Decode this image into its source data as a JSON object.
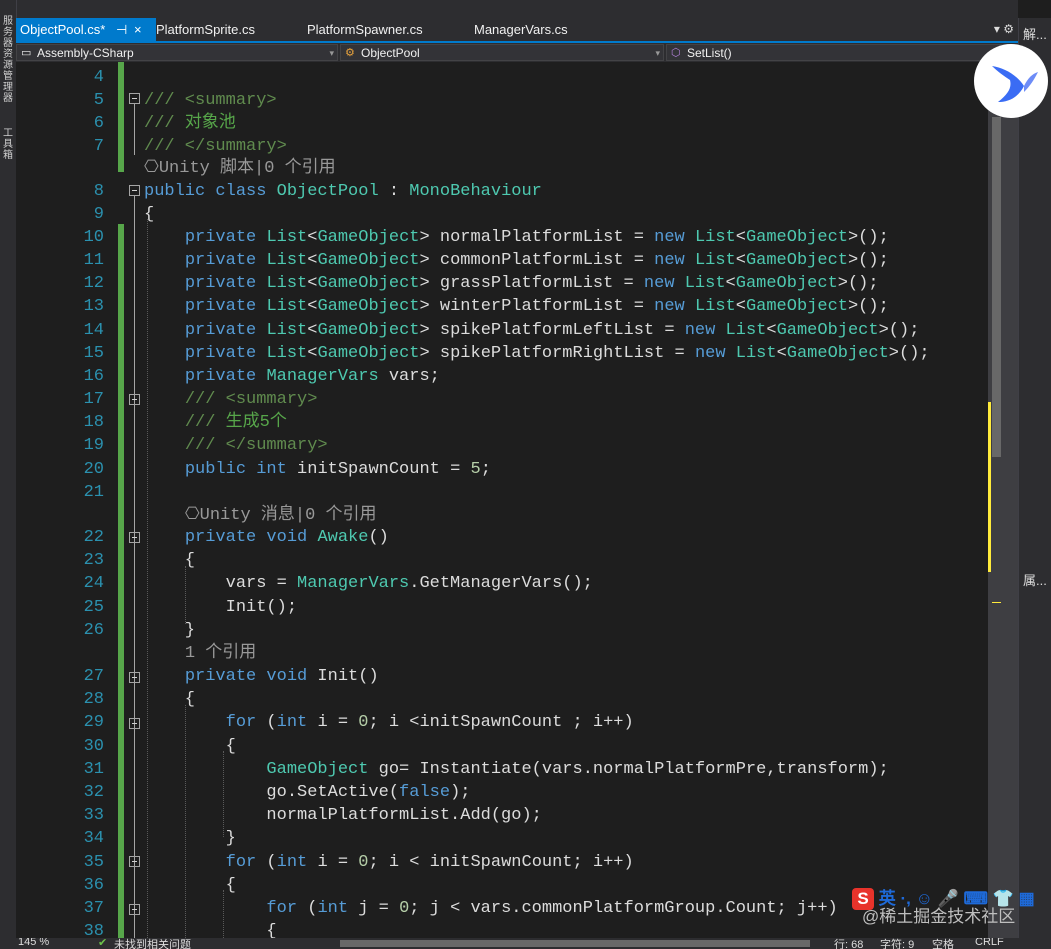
{
  "left_strip": {
    "item1": "服务器资源管理器",
    "item2": "工具箱"
  },
  "tabs": [
    {
      "label": "ObjectPool.cs*",
      "pin": "⊣",
      "close": "×"
    },
    {
      "label": "PlatformSprite.cs"
    },
    {
      "label": "PlatformSpawner.cs"
    },
    {
      "label": "ManagerVars.cs"
    }
  ],
  "tab_tools": "▾ ⚙",
  "nav": {
    "project": "Assembly-CSharp",
    "type": "ObjectPool",
    "member": "SetList()"
  },
  "lines": [
    {
      "n": "4",
      "t": ""
    },
    {
      "n": "5",
      "t": "<span class=\"doc\">/// &lt;summary&gt;</span>"
    },
    {
      "n": "6",
      "t": "<span class=\"doc\">/// </span><span class=\"cm\">对象池</span>"
    },
    {
      "n": "7",
      "t": "<span class=\"doc\">/// &lt;/summary&gt;</span>"
    },
    {
      "n": "",
      "t": "<span class=\"lens\">⎔Unity 脚本|0 个引用</span>"
    },
    {
      "n": "8",
      "t": "<span class=\"kw\">public class</span> <span class=\"ty\">ObjectPool</span> : <span class=\"ty\">MonoBehaviour</span>"
    },
    {
      "n": "9",
      "t": "{"
    },
    {
      "n": "10",
      "t": "    <span class=\"kw\">private</span> <span class=\"ty\">List</span>&lt;<span class=\"ty\">GameObject</span>&gt; normalPlatformList = <span class=\"kw\">new</span> <span class=\"ty\">List</span>&lt;<span class=\"ty\">GameObject</span>&gt;();"
    },
    {
      "n": "11",
      "t": "    <span class=\"kw\">private</span> <span class=\"ty\">List</span>&lt;<span class=\"ty\">GameObject</span>&gt; commonPlatformList = <span class=\"kw\">new</span> <span class=\"ty\">List</span>&lt;<span class=\"ty\">GameObject</span>&gt;();"
    },
    {
      "n": "12",
      "t": "    <span class=\"kw\">private</span> <span class=\"ty\">List</span>&lt;<span class=\"ty\">GameObject</span>&gt; grassPlatformList = <span class=\"kw\">new</span> <span class=\"ty\">List</span>&lt;<span class=\"ty\">GameObject</span>&gt;();"
    },
    {
      "n": "13",
      "t": "    <span class=\"kw\">private</span> <span class=\"ty\">List</span>&lt;<span class=\"ty\">GameObject</span>&gt; winterPlatformList = <span class=\"kw\">new</span> <span class=\"ty\">List</span>&lt;<span class=\"ty\">GameObject</span>&gt;();"
    },
    {
      "n": "14",
      "t": "    <span class=\"kw\">private</span> <span class=\"ty\">List</span>&lt;<span class=\"ty\">GameObject</span>&gt; spikePlatformLeftList = <span class=\"kw\">new</span> <span class=\"ty\">List</span>&lt;<span class=\"ty\">GameObject</span>&gt;();"
    },
    {
      "n": "15",
      "t": "    <span class=\"kw\">private</span> <span class=\"ty\">List</span>&lt;<span class=\"ty\">GameObject</span>&gt; spikePlatformRightList = <span class=\"kw\">new</span> <span class=\"ty\">List</span>&lt;<span class=\"ty\">GameObject</span>&gt;();"
    },
    {
      "n": "16",
      "t": "    <span class=\"kw\">private</span> <span class=\"ty\">ManagerVars</span> vars;"
    },
    {
      "n": "17",
      "t": "    <span class=\"doc\">/// &lt;summary&gt;</span>"
    },
    {
      "n": "18",
      "t": "    <span class=\"doc\">/// </span><span class=\"cm\">生成5个</span>"
    },
    {
      "n": "19",
      "t": "    <span class=\"doc\">/// &lt;/summary&gt;</span>"
    },
    {
      "n": "20",
      "t": "    <span class=\"kw\">public int</span> initSpawnCount = <span class=\"num\">5</span>;"
    },
    {
      "n": "21",
      "t": ""
    },
    {
      "n": "",
      "t": "    <span class=\"lens\">⎔Unity 消息|0 个引用</span>"
    },
    {
      "n": "22",
      "t": "    <span class=\"kw\">private void</span> <span class=\"ty\">Awake</span>()"
    },
    {
      "n": "23",
      "t": "    {"
    },
    {
      "n": "24",
      "t": "        vars = <span class=\"ty\">ManagerVars</span>.GetManagerVars();"
    },
    {
      "n": "25",
      "t": "        Init();"
    },
    {
      "n": "26",
      "t": "    }"
    },
    {
      "n": "",
      "t": "    <span class=\"lens\">1 个引用</span>"
    },
    {
      "n": "27",
      "t": "    <span class=\"kw\">private void</span> Init()"
    },
    {
      "n": "28",
      "t": "    {"
    },
    {
      "n": "29",
      "t": "        <span class=\"kw\">for</span> (<span class=\"kw\">int</span> i = <span class=\"num\">0</span>; i &lt;initSpawnCount ; i++)"
    },
    {
      "n": "30",
      "t": "        {"
    },
    {
      "n": "31",
      "t": "            <span class=\"ty\">GameObject</span> go= Instantiate(vars.normalPlatformPre,transform);"
    },
    {
      "n": "32",
      "t": "            go.SetActive(<span class=\"kw\">false</span>);"
    },
    {
      "n": "33",
      "t": "            normalPlatformList.Add(go);"
    },
    {
      "n": "34",
      "t": "        }"
    },
    {
      "n": "35",
      "t": "        <span class=\"kw\">for</span> (<span class=\"kw\">int</span> i = <span class=\"num\">0</span>; i &lt; initSpawnCount; i++)"
    },
    {
      "n": "36",
      "t": "        {"
    },
    {
      "n": "37",
      "t": "            <span class=\"kw\">for</span> (<span class=\"kw\">int</span> j = <span class=\"num\">0</span>; j &lt; vars.commonPlatformGroup.Count; j++)"
    },
    {
      "n": "38",
      "t": "            {"
    }
  ],
  "right_panel": {
    "solution": "解...",
    "properties": "属..."
  },
  "status": {
    "zoom": "145 %",
    "issues": "未找到相关问题",
    "row": "行: 68",
    "col": "字符: 9",
    "spaces": "空格",
    "eol": "CRLF"
  },
  "ime": {
    "logo": "S",
    "text": "英 ·, ☺ 🎤 ⌨ 👕 ▦"
  },
  "watermark": "@稀土掘金技术社区"
}
